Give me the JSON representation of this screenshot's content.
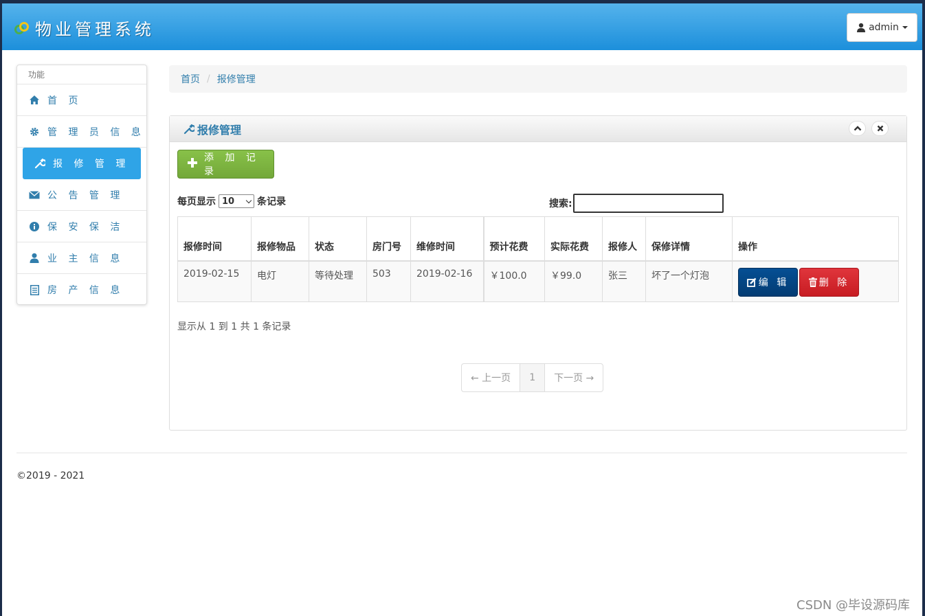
{
  "app": {
    "title": "物业管理系统"
  },
  "user": {
    "name": "admin"
  },
  "sidebar": {
    "heading": "功能",
    "items": [
      {
        "label": "首 页",
        "icon": "home-icon",
        "active": false
      },
      {
        "label": "管 理 员 信 息",
        "icon": "gear-icon",
        "active": false
      },
      {
        "label": "报 修 管 理",
        "icon": "wrench-icon",
        "active": true
      },
      {
        "label": "公 告 管 理",
        "icon": "envelope-icon",
        "active": false
      },
      {
        "label": "保 安 保 洁",
        "icon": "info-icon",
        "active": false
      },
      {
        "label": "业 主 信 息",
        "icon": "user-icon",
        "active": false
      },
      {
        "label": "房 产 信 息",
        "icon": "list-icon",
        "active": false
      }
    ]
  },
  "breadcrumb": {
    "home": "首页",
    "current": "报修管理"
  },
  "panel": {
    "title": "报修管理"
  },
  "toolbar": {
    "add_label": "添 加 记 录"
  },
  "table_controls": {
    "length_prefix": "每页显示",
    "length_value": "10",
    "length_suffix": "条记录",
    "search_label": "搜索:"
  },
  "table": {
    "headers": [
      "报修时间",
      "报修物品",
      "状态",
      "房门号",
      "维修时间",
      "预计花费",
      "实际花费",
      "报修人",
      "保修详情",
      "操作"
    ],
    "rows": [
      {
        "report_time": "2019-02-15",
        "item": "电灯",
        "status": "等待处理",
        "room": "503",
        "repair_time": "2019-02-16",
        "est_cost": "￥100.0",
        "act_cost": "￥99.0",
        "reporter": "张三",
        "detail": "坏了一个灯泡",
        "edit_label": "编 辑",
        "delete_label": "删 除"
      }
    ]
  },
  "info": "显示从 1 到 1 共 1 条记录",
  "pager": {
    "prev": "← 上一页",
    "current": "1",
    "next": "下一页 →"
  },
  "footer": "©2019 - 2021",
  "watermark": "CSDN @毕设源码库",
  "colors": {
    "topbar": "#1c8fdb",
    "accent": "#2fa4e7",
    "link": "#317eac",
    "add": "#73a839",
    "edit": "#033c73",
    "delete": "#c71c22"
  }
}
